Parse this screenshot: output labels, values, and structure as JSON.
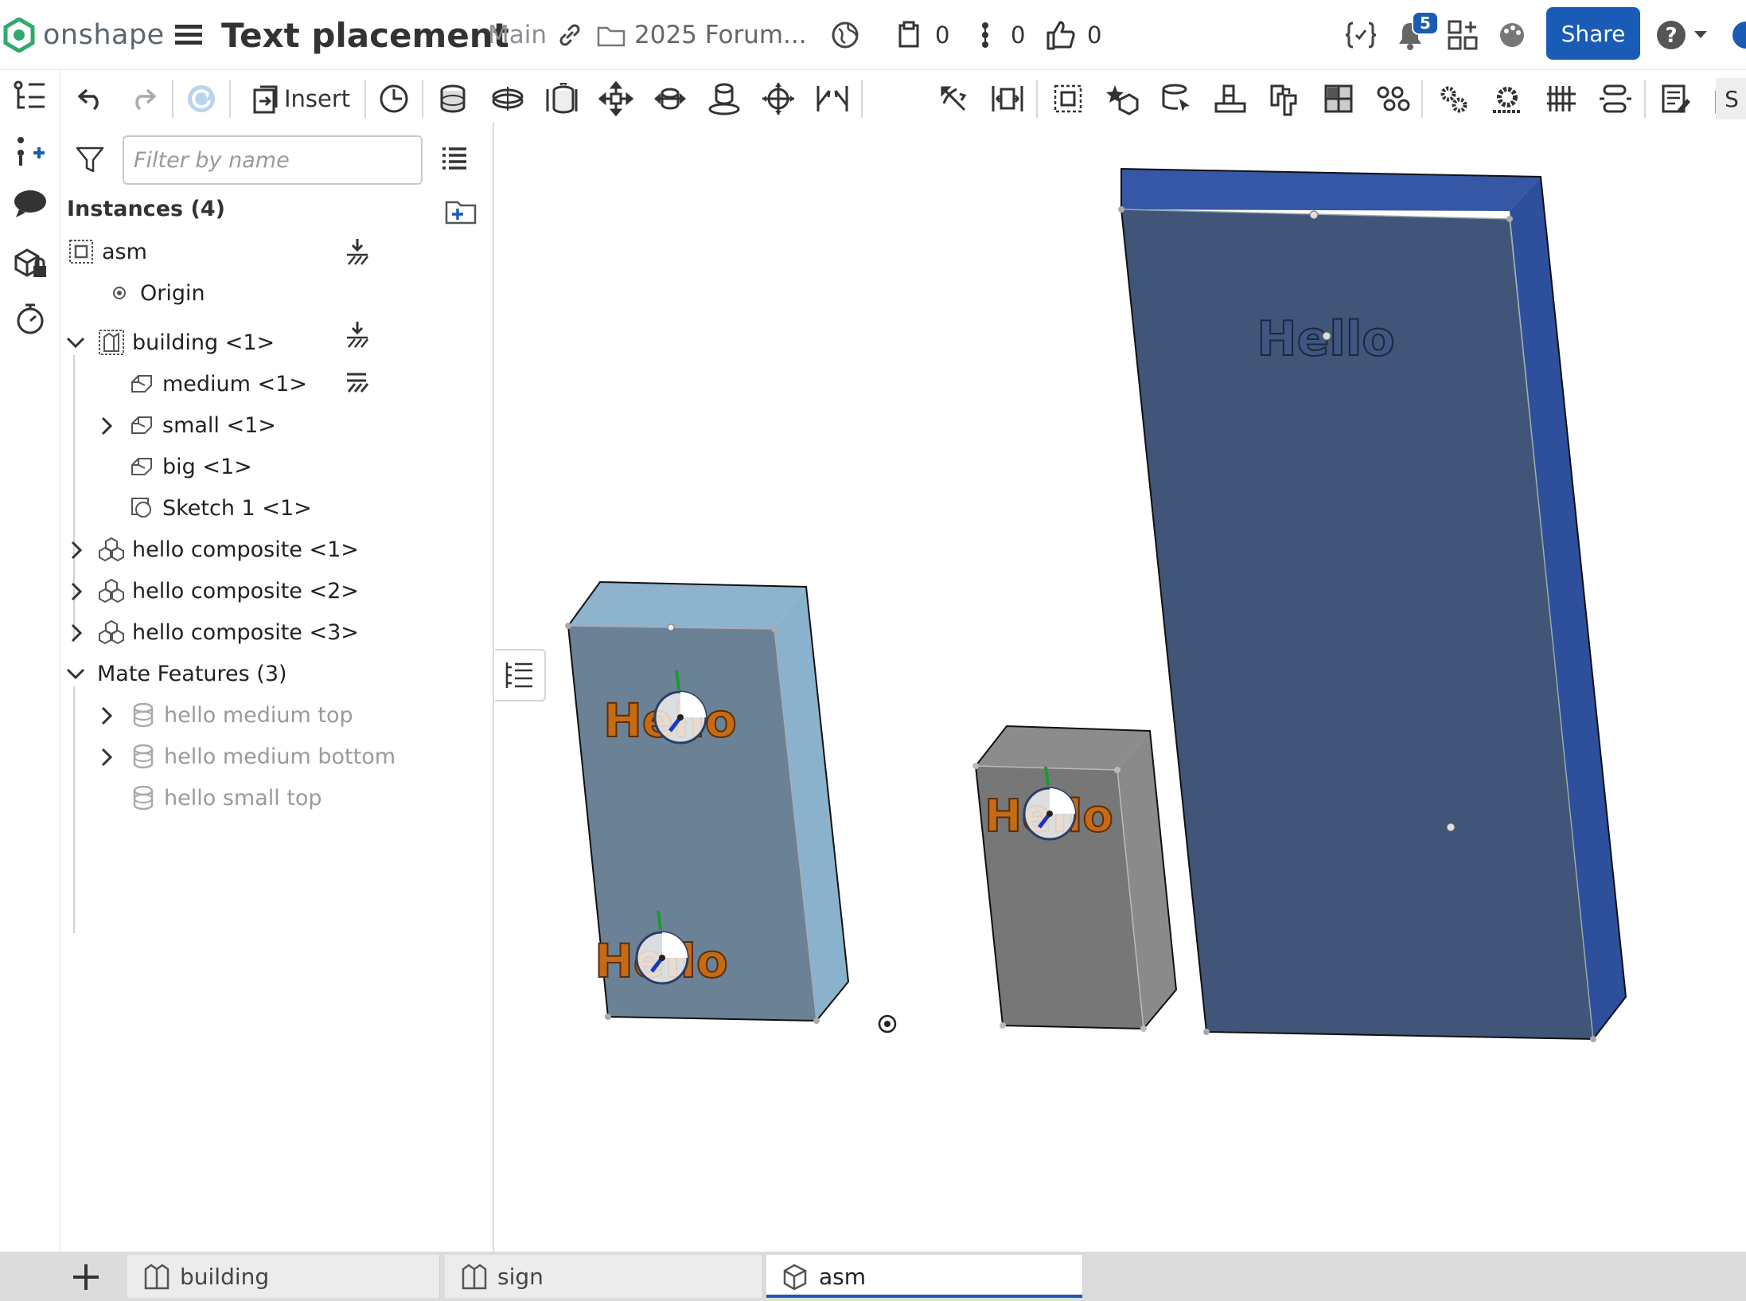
{
  "header": {
    "brand": "onshape",
    "document_title": "Text placement",
    "workspace": "Main",
    "folder": "2025 Forum...",
    "versions_count": "0",
    "branches_count": "0",
    "likes_count": "0",
    "notifications_count": "5",
    "share_label": "Share",
    "icons": [
      "onshape-logo",
      "menu-icon",
      "link-icon",
      "folder-icon",
      "globe-icon",
      "versions-icon",
      "branches-icon",
      "like-icon",
      "variables-icon",
      "bell-icon",
      "app-store-icon",
      "appearance-icon",
      "help-icon",
      "chevron-down-icon"
    ]
  },
  "toolbar": {
    "insert_label": "Insert",
    "overflow_label": "S",
    "tools": [
      "undo-icon",
      "redo-icon",
      "refresh-icon",
      "insert-icon",
      "clock-icon",
      "fastened-mate-icon",
      "revolute-mate-icon",
      "slider-mate-icon",
      "planar-mate-icon",
      "cylindrical-mate-icon",
      "pin-slot-mate-icon",
      "ball-mate-icon",
      "parallel-mate-icon",
      "tangent-mate-icon",
      "width-mate-icon",
      "group-icon",
      "mate-connector-icon",
      "relation-icon",
      "assembly-pattern-icon",
      "replicate-icon",
      "section-view-icon",
      "explode-icon",
      "gear-icon",
      "gear-relation-icon",
      "rack-pinion-icon",
      "linear-relation-icon",
      "bom-icon",
      "named-views-icon"
    ]
  },
  "rail": {
    "icons": [
      "feature-tree-icon",
      "add-mate-icon",
      "comments-icon",
      "parts-lock-icon",
      "timer-icon",
      "search-zoom-icon"
    ]
  },
  "panel": {
    "filter_placeholder": "Filter by name",
    "instances_header": "Instances (4)",
    "tree": [
      {
        "label": "asm",
        "icon": "assembly-icon",
        "level": 0
      },
      {
        "label": "Origin",
        "icon": "origin-icon",
        "level": 1
      },
      {
        "label": "building <1>",
        "icon": "part-studio-icon",
        "level": 0,
        "expanded": true
      },
      {
        "label": "medium <1>",
        "icon": "part-icon",
        "level": 1
      },
      {
        "label": "small <1>",
        "icon": "part-icon",
        "level": 1,
        "collapsed": true
      },
      {
        "label": "big <1>",
        "icon": "part-icon",
        "level": 1
      },
      {
        "label": "Sketch 1 <1>",
        "icon": "sketch-icon",
        "level": 1
      },
      {
        "label": "hello composite <1>",
        "icon": "composite-icon",
        "level": 0,
        "collapsed": true
      },
      {
        "label": "hello composite <2>",
        "icon": "composite-icon",
        "level": 0,
        "collapsed": true
      },
      {
        "label": "hello composite <3>",
        "icon": "composite-icon",
        "level": 0,
        "collapsed": true
      }
    ],
    "mates_header": "Mate Features (3)",
    "mates": [
      {
        "label": "hello medium top",
        "icon": "fastened-mate-icon",
        "collapsed": true
      },
      {
        "label": "hello medium bottom",
        "icon": "fastened-mate-icon",
        "collapsed": true
      },
      {
        "label": "hello small top",
        "icon": "fastened-mate-icon",
        "collapsed": false
      }
    ]
  },
  "viewport": {
    "engraved_text": "Hello",
    "colors": {
      "big_front": "#415578",
      "big_side": "#2e4f9c",
      "big_top": "#3557a6",
      "medium_front": "#6b8196",
      "medium_side": "#8bb2cc",
      "medium_top": "#8eb3cc",
      "small_front": "#777777",
      "small_side": "#8a8a8a",
      "small_top": "#8c8c8c",
      "hello_orange": "#c66a14"
    }
  },
  "tabs": [
    {
      "label": "building",
      "icon": "part-studio-icon",
      "active": false
    },
    {
      "label": "sign",
      "icon": "part-studio-icon",
      "active": false
    },
    {
      "label": "asm",
      "icon": "assembly-icon",
      "active": true
    }
  ],
  "colors": {
    "accent": "#1a5bb5",
    "text": "#222222",
    "muted_text": "#9a9a9a"
  }
}
